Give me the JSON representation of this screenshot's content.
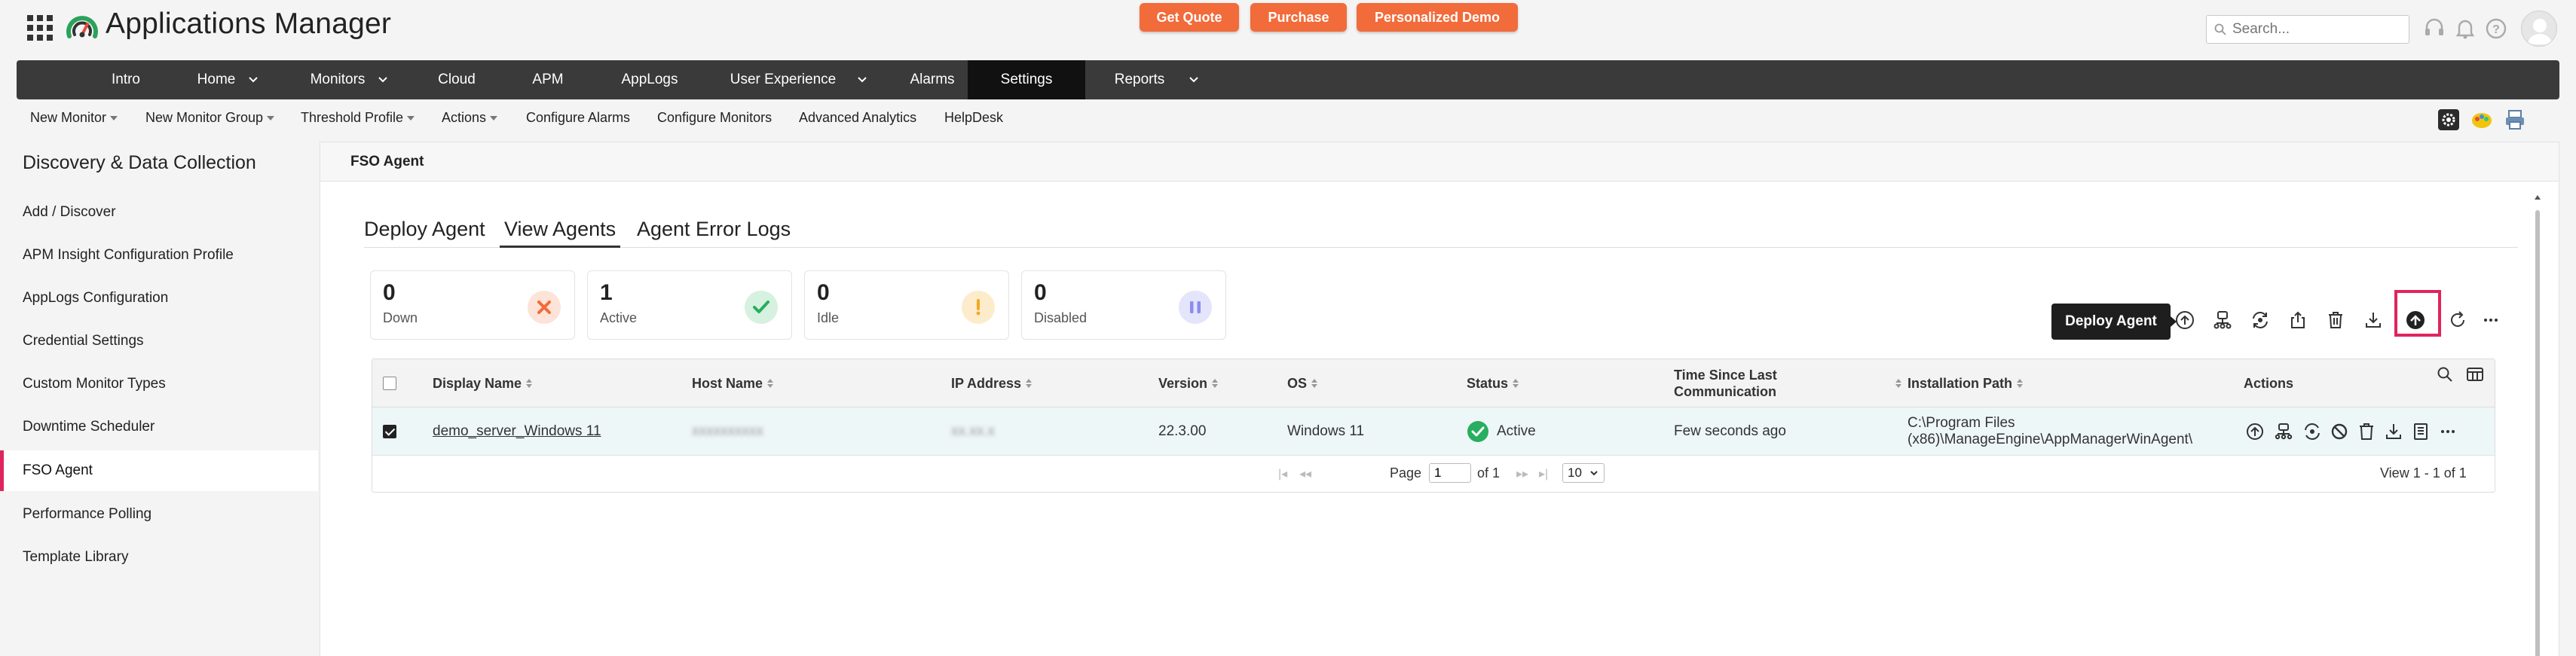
{
  "header": {
    "app_title": "Applications Manager",
    "buttons": {
      "get_quote": "Get Quote",
      "purchase": "Purchase",
      "demo": "Personalized Demo"
    },
    "search_placeholder": "Search...",
    "icons": [
      "headset-icon",
      "bell-icon",
      "help-icon",
      "user-avatar"
    ]
  },
  "main_nav": {
    "items": [
      {
        "label": "Intro"
      },
      {
        "label": "Home",
        "dropdown": true
      },
      {
        "label": "Monitors",
        "dropdown": true
      },
      {
        "label": "Cloud"
      },
      {
        "label": "APM"
      },
      {
        "label": "AppLogs"
      },
      {
        "label": "User Experience",
        "dropdown": true
      },
      {
        "label": "Alarms"
      },
      {
        "label": "Settings",
        "active": true
      },
      {
        "label": "Reports",
        "dropdown": true
      }
    ]
  },
  "sub_nav": {
    "items": [
      "New Monitor",
      "New Monitor Group",
      "Threshold Profile",
      "Actions",
      "Configure Alarms",
      "Configure Monitors",
      "Advanced Analytics",
      "HelpDesk"
    ]
  },
  "sidebar": {
    "title": "Discovery & Data Collection",
    "items": [
      "Add / Discover",
      "APM Insight Configuration Profile",
      "AppLogs Configuration",
      "Credential Settings",
      "Custom Monitor Types",
      "Downtime Scheduler",
      "FSO Agent",
      "Performance Polling",
      "Template Library"
    ],
    "active": "FSO Agent"
  },
  "breadcrumb": "FSO Agent",
  "tabs": [
    "Deploy Agent",
    "View Agents",
    "Agent Error Logs"
  ],
  "active_tab": "View Agents",
  "stats": [
    {
      "count": "0",
      "label": "Down"
    },
    {
      "count": "1",
      "label": "Active"
    },
    {
      "count": "0",
      "label": "Idle"
    },
    {
      "count": "0",
      "label": "Disabled"
    }
  ],
  "tooltip": "Deploy Agent",
  "table": {
    "columns": [
      "Display Name",
      "Host Name",
      "IP Address",
      "Version",
      "OS",
      "Status",
      "Time Since Last",
      "Communication",
      "Installation Path",
      "Actions"
    ],
    "rows": [
      {
        "display_name": "demo_server_Windows 11",
        "host_name": "xxxxxxxxxx",
        "ip_address": "xx.xx.x",
        "version": "22.3.00",
        "os": "Windows 11",
        "status": "Active",
        "time_since": "Few seconds ago",
        "path_line1": "C:\\Program Files",
        "path_line2": "(x86)\\ManageEngine\\AppManagerWinAgent\\"
      }
    ]
  },
  "pager": {
    "page_label": "Page",
    "page_value": "1",
    "of_label": "of 1",
    "page_size": "10",
    "view_label": "View 1 - 1 of 1"
  },
  "colors": {
    "accent": "#e0245e",
    "cta": "#f26b3a",
    "nav_bg": "#3a3a3a",
    "active_green": "#27ae60",
    "down_orange": "#f26b3a",
    "idle_amber": "#f5a623",
    "disabled_violet": "#8c8cf0"
  }
}
